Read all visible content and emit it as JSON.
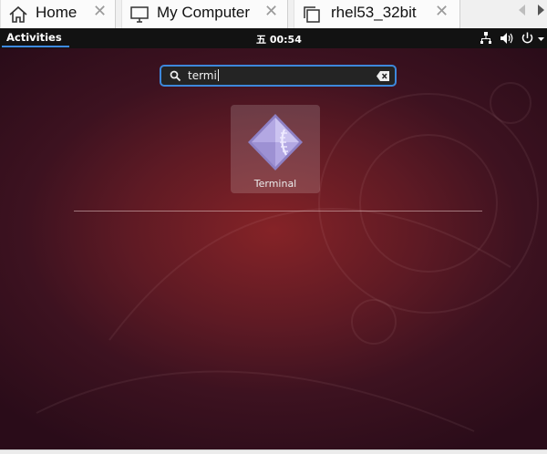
{
  "host": {
    "tabs": [
      {
        "label": "Home",
        "icon": "home-icon"
      },
      {
        "label": "My Computer",
        "icon": "monitor-icon"
      },
      {
        "label": "rhel53_32bit",
        "icon": "vm-copy-icon"
      }
    ],
    "close_glyph": "✕"
  },
  "guest": {
    "topbar": {
      "activities": "Activities",
      "clock": "五 00:54",
      "icons": [
        "network-icon",
        "volume-icon",
        "power-icon",
        "menu-arrow-icon"
      ]
    },
    "search": {
      "value": "termi",
      "icon": "search-icon",
      "clear_icon": "clear-icon"
    },
    "results": [
      {
        "label": "Terminal",
        "icon": "terminal-app-icon"
      }
    ]
  },
  "colors": {
    "topbar": "#121212",
    "search_border": "#3d88db",
    "activities_underline": "#3f8ae0",
    "wallpaper_center": "#852327",
    "wallpaper_edge": "#2a0c19",
    "icon_purple": "#9b8fd0"
  }
}
